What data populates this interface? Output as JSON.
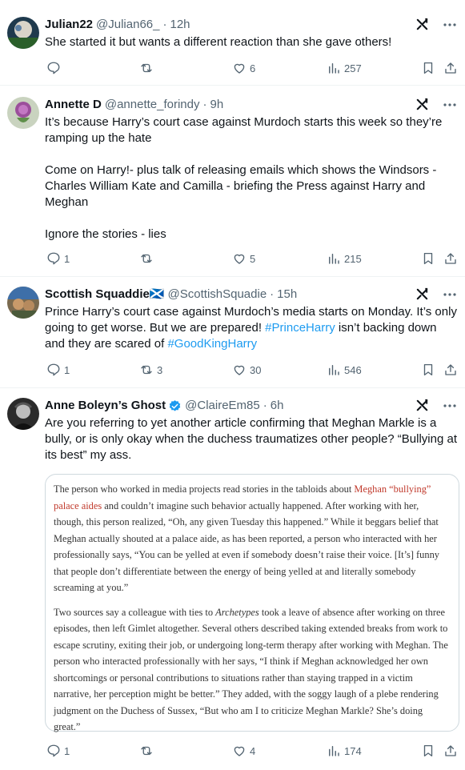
{
  "tweets": [
    {
      "name": "Julian22",
      "handle": "@Julian66_",
      "time": "12h",
      "text": "She started it but wants a different reaction than she gave others!",
      "replies": "",
      "retweets": "",
      "likes": "6",
      "views": "257"
    },
    {
      "name": "Annette D",
      "handle": "@annette_forindy",
      "time": "9h",
      "text": "It’s because Harry’s court case against Murdoch starts this week so they’re ramping up the hate\n\nCome on Harry!- plus talk of releasing emails which shows the Windsors - Charles William Kate and Camilla - briefing the Press against Harry and Meghan\n\nIgnore the stories - lies",
      "replies": "1",
      "retweets": "",
      "likes": "5",
      "views": "215"
    },
    {
      "name": "Scottish Squaddie🏴󠁧󠁢󠁳󠁣󠁴󠁿",
      "handle": "@ScottishSquadie",
      "time": "15h",
      "text_a": "Prince Harry’s court case against Murdoch’s media starts on Monday. It’s only going to get worse. But we are prepared! ",
      "hashtag1": "#PrinceHarry",
      "text_b": " isn’t backing down and they are scared of ",
      "hashtag2": "#GoodKingHarry",
      "replies": "1",
      "retweets": "3",
      "likes": "30",
      "views": "546"
    },
    {
      "name": "Anne Boleyn’s Ghost",
      "handle": "@ClaireEm85",
      "time": "6h",
      "text": "Are you referring to yet another article confirming that Meghan Markle is a bully, or is only okay when the duchess traumatizes other people? “Bullying at its best” my ass.",
      "replies": "1",
      "retweets": "",
      "likes": "4",
      "views": "174"
    }
  ],
  "article": {
    "p1_a": "The person who worked in media projects read stories in the tabloids about ",
    "p1_red": "Meghan “bullying” palace aides",
    "p1_b": " and couldn’t imagine such behavior actually happened. After working with her, though, this person realized, “Oh, any given Tuesday this happened.” While it beggars belief that Meghan actually shouted at a palace aide, as has been reported, a person who interacted with her professionally says, “You can be yelled at even if somebody doesn’t raise their voice. [It’s] funny that people don’t differentiate between the energy of being yelled at and literally somebody screaming at you.”",
    "p2_a": "Two sources say a colleague with ties to ",
    "p2_ital": "Archetypes",
    "p2_b": " took a leave of absence after working on three episodes, then left Gimlet altogether. Several others described taking extended breaks from work to escape scrutiny, exiting their job, or undergoing long-term therapy after working with Meghan. The person who interacted professionally with her says, “I think if Meghan acknowledged her own shortcomings or personal contributions to situations rather than staying trapped in a victim narrative, her perception might be better.” They added, with the soggy laugh of a plebe rendering judgment on the Duchess of Sussex, “But who am I to criticize Meghan Markle? She’s doing great.”"
  },
  "separator": "·",
  "colors": {
    "accent": "#1d9bf0",
    "muted": "#536471",
    "text": "#0f1419",
    "verified": "#1d9bf0"
  }
}
